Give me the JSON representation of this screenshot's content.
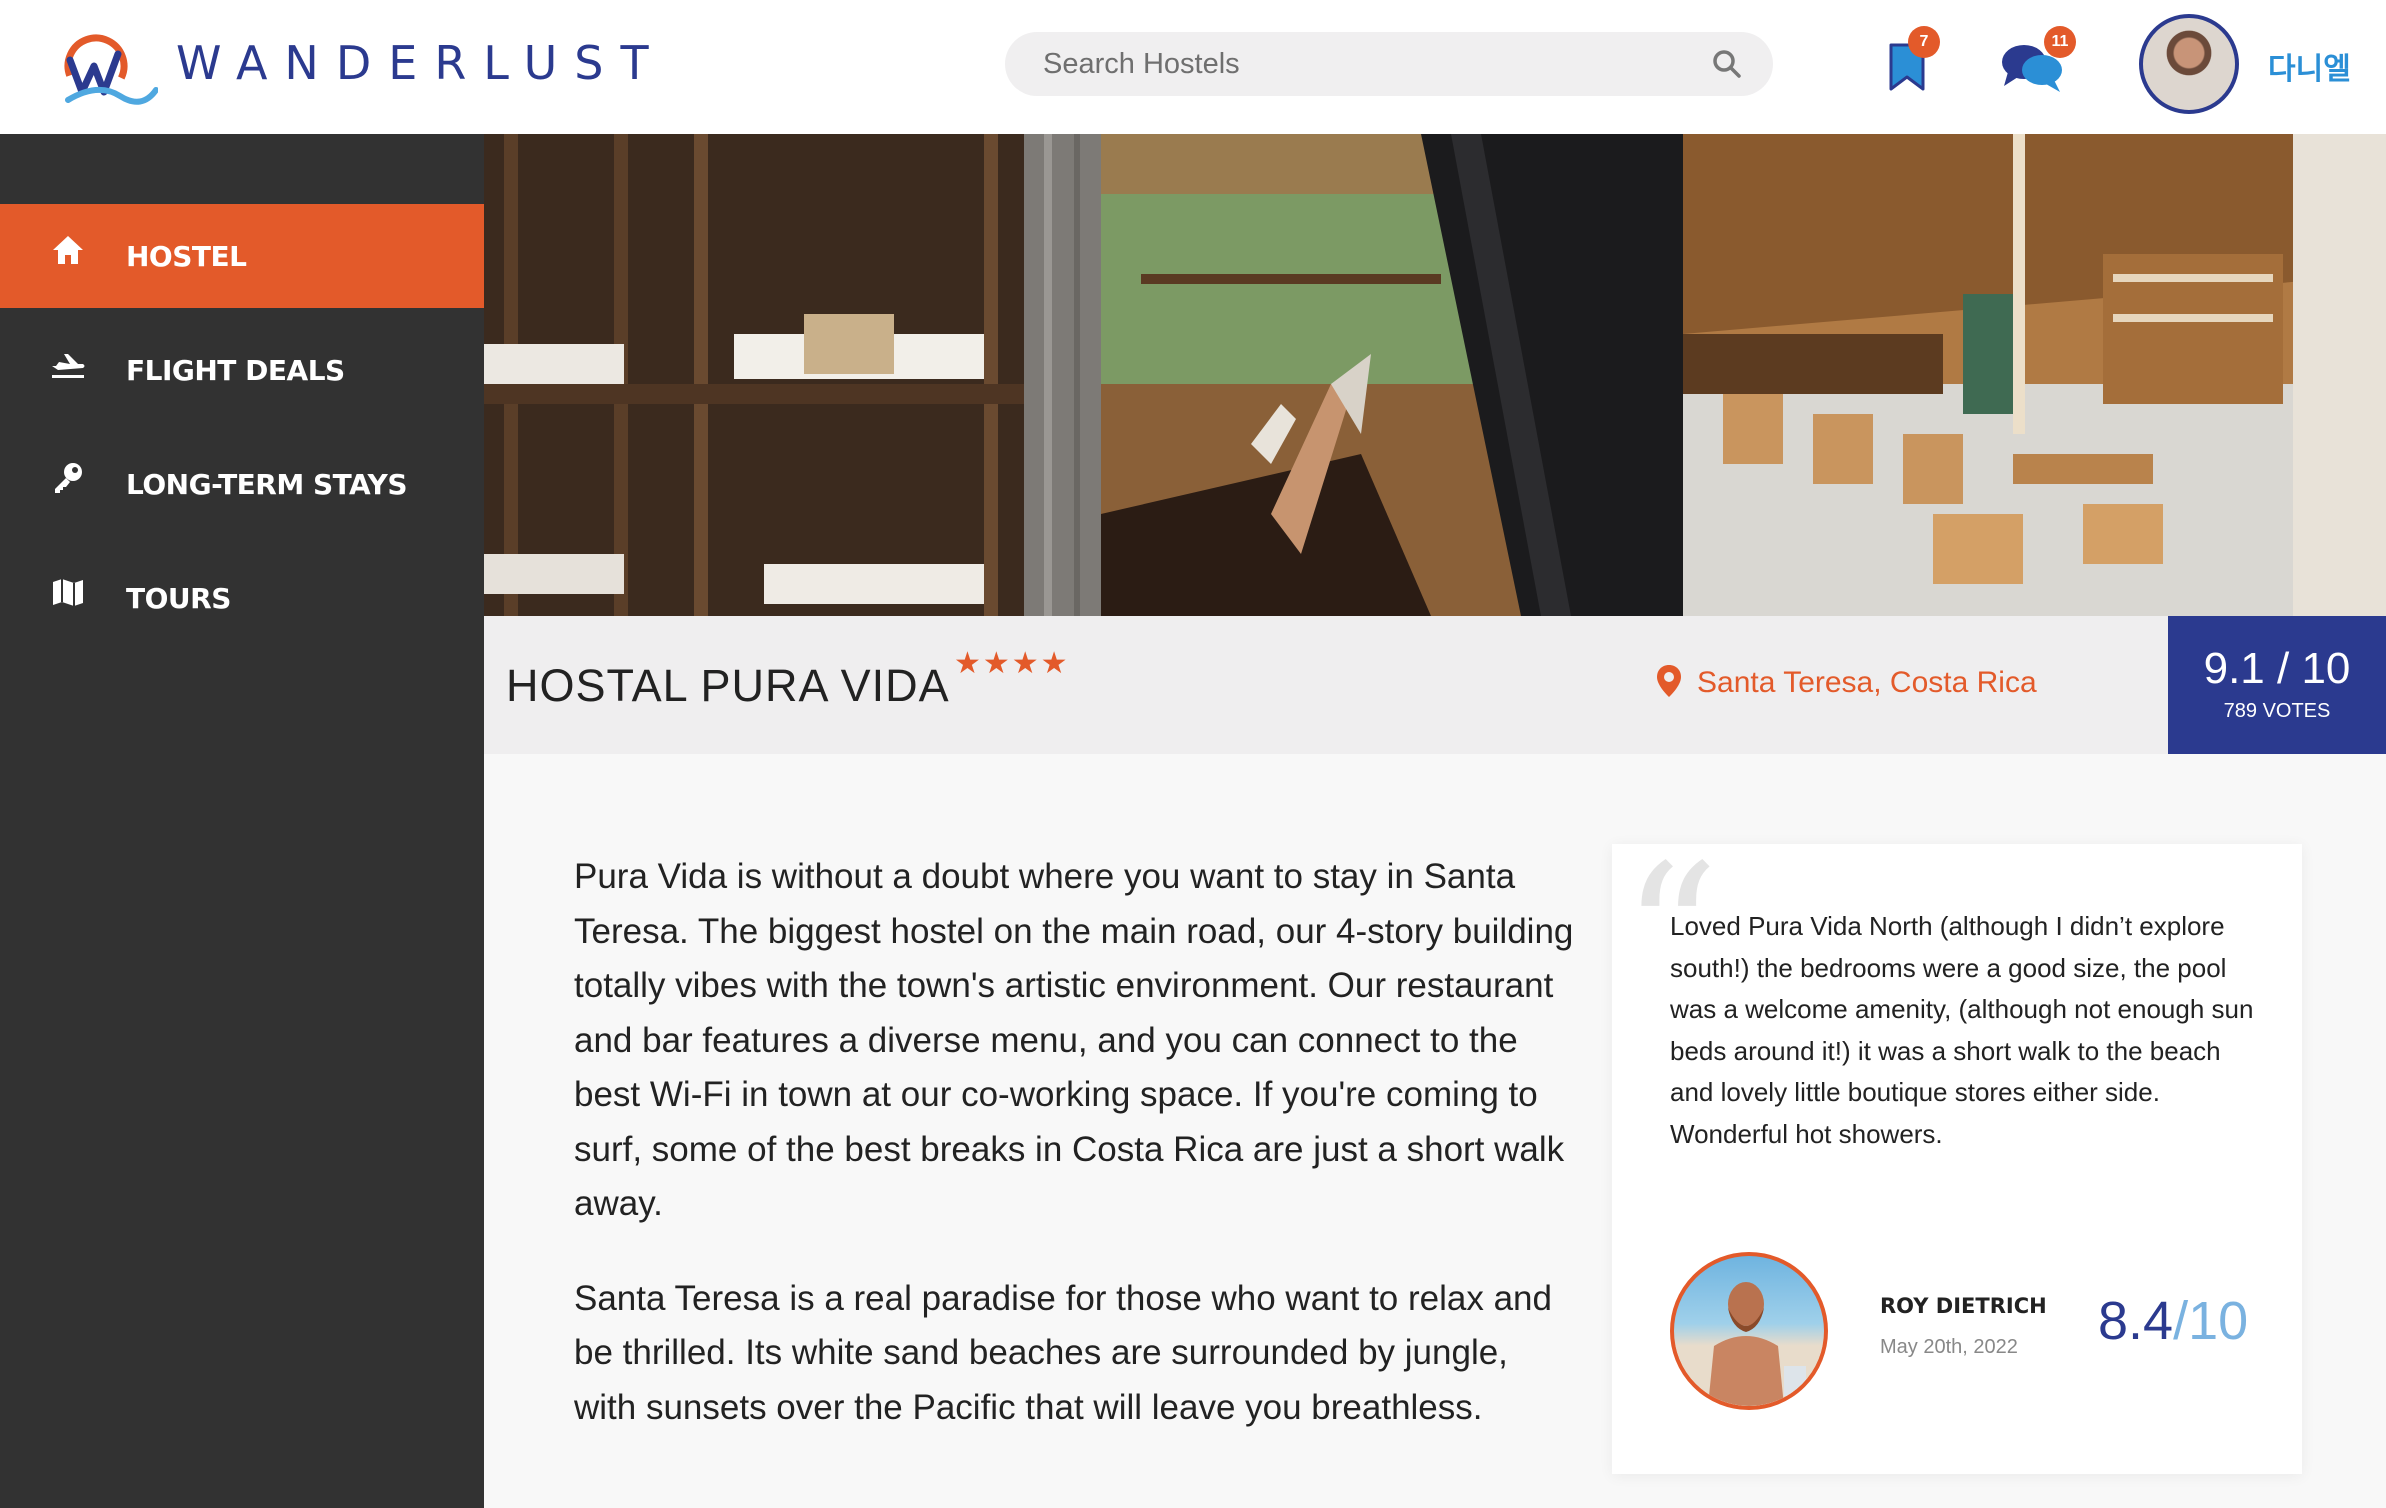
{
  "brand": {
    "name": "WANDERLUST",
    "accent": "#e35a2a",
    "primary": "#2b3a8f"
  },
  "search": {
    "placeholder": "Search Hostels"
  },
  "header": {
    "bookmarks_count": "7",
    "messages_count": "11",
    "username": "다니엘"
  },
  "sidebar": {
    "items": [
      {
        "label": "HOSTEL",
        "icon": "home-icon",
        "active": true
      },
      {
        "label": "FLIGHT DEALS",
        "icon": "plane-icon",
        "active": false
      },
      {
        "label": "LONG-TERM STAYS",
        "icon": "key-icon",
        "active": false
      },
      {
        "label": "TOURS",
        "icon": "map-icon",
        "active": false
      }
    ]
  },
  "hostel": {
    "name": "HOSTAL PURA VIDA",
    "stars": "★★★★",
    "star_count": 4,
    "location": "Santa Teresa, Costa Rica",
    "score": "9.1 / 10",
    "votes": "789 VOTES",
    "description": [
      "Pura Vida is without a doubt where you want to stay in Santa Teresa. The biggest hostel on the main road, our 4-story building totally vibes with the town's artistic environment. Our restaurant and bar features a diverse menu, and you can connect to the best Wi-Fi in town at our co-working space. If you're coming to surf, some of the best breaks in Costa Rica are just a short walk away.",
      "Santa Teresa is a real paradise for those who want to relax and be thrilled. Its white sand beaches are surrounded by jungle, with sunsets over the Pacific that will leave you breathless."
    ]
  },
  "review": {
    "text": "Loved Pura Vida North (although I didn’t explore south!) the bedrooms were a good size, the pool was a welcome amenity, (although not enough sun beds around it!) it was a short walk to the beach and lovely little boutique stores either side. Wonderful hot showers.",
    "author": "ROY DIETRICH",
    "date": "May 20th, 2022",
    "score_num": "8.4",
    "score_den": "/10"
  }
}
